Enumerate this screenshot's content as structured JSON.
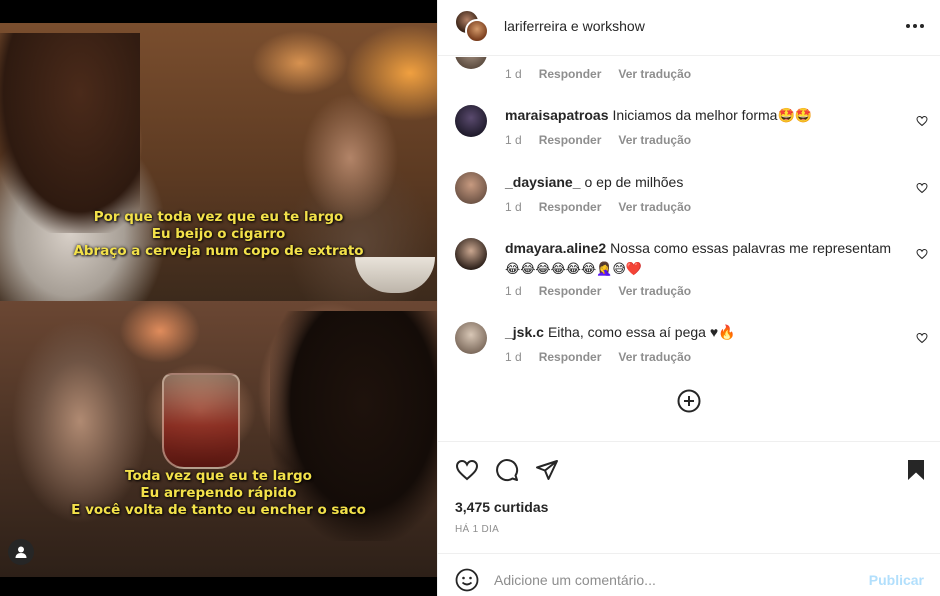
{
  "post": {
    "lyrics_top": [
      "Por que toda vez que eu te largo",
      "Eu beijo o cigarro",
      "Abraço a cerveja num copo de extrato"
    ],
    "lyrics_bottom": [
      "Toda vez que eu te largo",
      "Eu arrependo rápido",
      "E você volta de tanto eu encher o saco"
    ]
  },
  "header": {
    "title": "lariferreira e workshow"
  },
  "comment_meta": {
    "time": "1 d",
    "reply_label": "Responder",
    "translate_label": "Ver tradução"
  },
  "comments": [
    {
      "user": "maraisapatroas",
      "text": "Iniciamos da melhor forma🤩🤩",
      "time": "1 d"
    },
    {
      "user": "_daysiane_",
      "text": "o ep de milhões",
      "time": "1 d"
    },
    {
      "user": "dmayara.aline2",
      "text": "Nossa como essas palavras me representam",
      "text2": "😂😂😂😂😂😂🤦‍♀️😅❤️",
      "time": "1 d"
    },
    {
      "user": "_jsk.c",
      "text": "Eitha, como essa aí pega ♥🔥",
      "time": "1 d"
    }
  ],
  "stats": {
    "likes": "3,475 curtidas",
    "timestamp": "HÁ 1 DIA"
  },
  "composer": {
    "placeholder": "Adicione um comentário...",
    "publish_label": "Publicar"
  },
  "icons": {
    "like": "heart-outline-icon",
    "comment": "comment-bubble-icon",
    "share": "paper-plane-icon",
    "save": "bookmark-filled-icon",
    "emoji": "smiley-icon",
    "more": "more-dots-icon",
    "add": "plus-circle-icon",
    "tag": "user-tag-icon"
  },
  "colors": {
    "lyric_text": "#f3e14a",
    "publish_disabled": "#b2dffc",
    "meta_gray": "#8e8e8e"
  }
}
